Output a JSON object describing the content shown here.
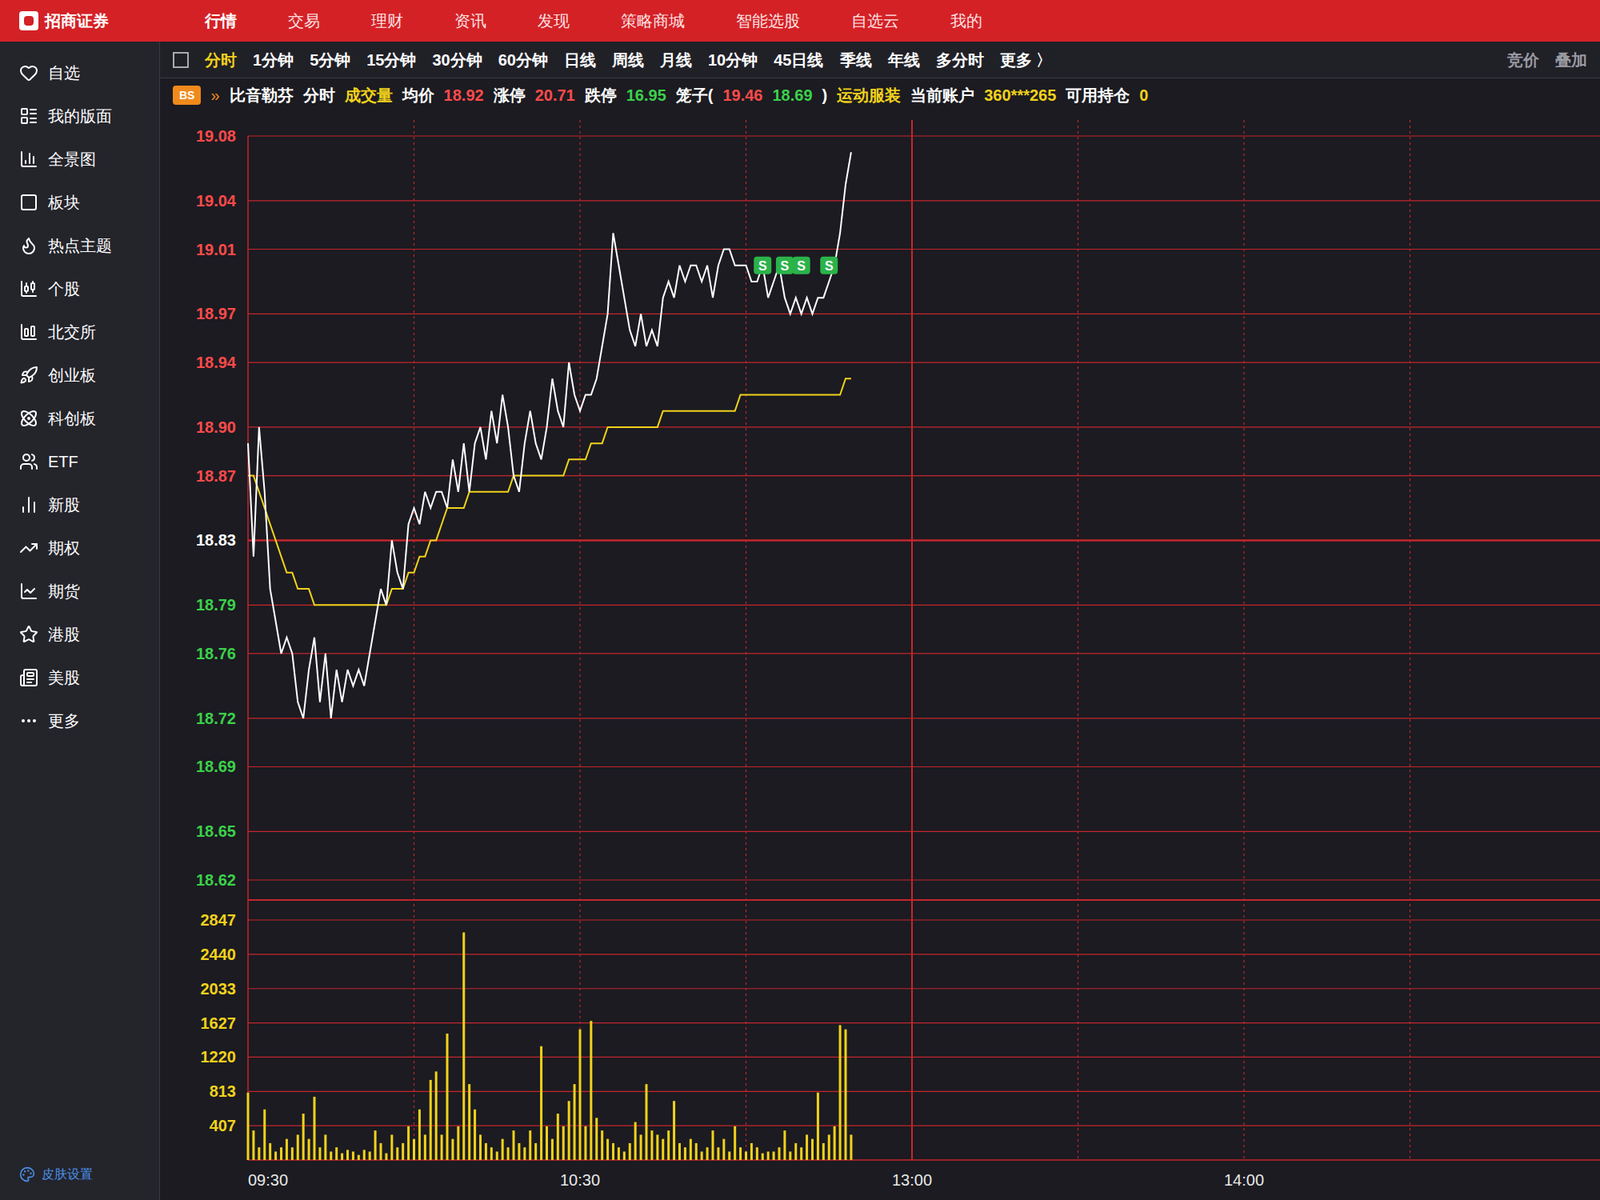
{
  "app": {
    "logo": "招商证券",
    "menu": [
      {
        "label": "行情",
        "selected": true
      },
      {
        "label": "交易",
        "selected": false
      },
      {
        "label": "理财",
        "selected": false
      },
      {
        "label": "资讯",
        "selected": false
      },
      {
        "label": "发现",
        "selected": false
      },
      {
        "label": "策略商城",
        "selected": false
      },
      {
        "label": "智能选股",
        "selected": false
      },
      {
        "label": "自选云",
        "selected": false
      },
      {
        "label": "我的",
        "selected": false
      }
    ]
  },
  "sidebar": {
    "items": [
      {
        "label": "自选",
        "selected": false
      },
      {
        "label": "我的版面",
        "selected": false
      },
      {
        "label": "全景图",
        "selected": false
      },
      {
        "label": "板块",
        "selected": false
      },
      {
        "label": "热点主题",
        "selected": false
      },
      {
        "label": "个股",
        "selected": false
      },
      {
        "label": "北交所",
        "selected": false
      },
      {
        "label": "创业板",
        "selected": false
      },
      {
        "label": "科创板",
        "selected": false
      },
      {
        "label": "ETF",
        "selected": false
      },
      {
        "label": "新股",
        "selected": false
      },
      {
        "label": "期权",
        "selected": false
      },
      {
        "label": "期货",
        "selected": false
      },
      {
        "label": "港股",
        "selected": false
      },
      {
        "label": "美股",
        "selected": false
      },
      {
        "label": "更多",
        "selected": false
      }
    ],
    "footer": "皮肤设置"
  },
  "periods": [
    {
      "label": "分时",
      "selected": true
    },
    {
      "label": "1分钟",
      "selected": false
    },
    {
      "label": "5分钟",
      "selected": false
    },
    {
      "label": "15分钟",
      "selected": false
    },
    {
      "label": "30分钟",
      "selected": false
    },
    {
      "label": "60分钟",
      "selected": false
    },
    {
      "label": "日线",
      "selected": false
    },
    {
      "label": "周线",
      "selected": false
    },
    {
      "label": "月线",
      "selected": false
    },
    {
      "label": "10分钟",
      "selected": false
    },
    {
      "label": "45日线",
      "selected": false
    },
    {
      "label": "季线",
      "selected": false
    },
    {
      "label": "年线",
      "selected": false
    },
    {
      "label": "多分时",
      "selected": false
    },
    {
      "label": "更多 〉",
      "selected": false
    }
  ],
  "toolbar_right": [
    "竞价",
    "叠加"
  ],
  "info": {
    "badge": "BS",
    "collapse": "»",
    "segments": [
      {
        "text": "比音勒芬",
        "color": "#ffffff"
      },
      {
        "text": "分时",
        "color": "#ffffff"
      },
      {
        "text": "成交量",
        "color": "#f2d21b"
      },
      {
        "text": "均价",
        "color": "#ffffff"
      },
      {
        "text": "18.92",
        "color": "#ff4a4a"
      },
      {
        "text": "涨停",
        "color": "#ffffff"
      },
      {
        "text": "20.71",
        "color": "#ff4a4a"
      },
      {
        "text": "跌停",
        "color": "#ffffff"
      },
      {
        "text": "16.95",
        "color": "#3bd14a"
      },
      {
        "text": "笼子(",
        "color": "#ffffff"
      },
      {
        "text": "19.46",
        "color": "#ff4a4a"
      },
      {
        "text": "18.69",
        "color": "#3bd14a"
      },
      {
        "text": ")",
        "color": "#ffffff"
      },
      {
        "text": "运动服装",
        "color": "#f2d21b"
      },
      {
        "text": "当前账户",
        "color": "#ffffff"
      },
      {
        "text": "360***265",
        "color": "#f2d21b"
      },
      {
        "text": "可用持仓",
        "color": "#ffffff"
      },
      {
        "text": "0",
        "color": "#f2d21b"
      }
    ]
  },
  "chart": {
    "price_ticks": [
      {
        "label": "19.08",
        "color": "#ff4a4a"
      },
      {
        "label": "19.04",
        "color": "#ff4a4a"
      },
      {
        "label": "19.01",
        "color": "#ff4a4a"
      },
      {
        "label": "18.97",
        "color": "#ff4a4a"
      },
      {
        "label": "18.94",
        "color": "#ff4a4a"
      },
      {
        "label": "18.90",
        "color": "#ff4a4a"
      },
      {
        "label": "18.87",
        "color": "#ff4a4a"
      },
      {
        "label": "18.83",
        "color": "#ffffff"
      },
      {
        "label": "18.79",
        "color": "#3bd14a"
      },
      {
        "label": "18.76",
        "color": "#3bd14a"
      },
      {
        "label": "18.72",
        "color": "#3bd14a"
      },
      {
        "label": "18.69",
        "color": "#3bd14a"
      },
      {
        "label": "18.65",
        "color": "#3bd14a"
      },
      {
        "label": "18.62",
        "color": "#3bd14a"
      }
    ],
    "volume_ticks": [
      "2847",
      "2440",
      "2033",
      "1627",
      "1220",
      "813",
      "407"
    ],
    "time_labels": [
      "09:30",
      "10:30",
      "13:00",
      "14:00"
    ],
    "price": [
      18.89,
      18.82,
      18.9,
      18.86,
      18.8,
      18.78,
      18.76,
      18.77,
      18.76,
      18.73,
      18.72,
      18.75,
      18.77,
      18.73,
      18.76,
      18.72,
      18.75,
      18.73,
      18.75,
      18.74,
      18.75,
      18.74,
      18.76,
      18.78,
      18.8,
      18.79,
      18.83,
      18.81,
      18.8,
      18.84,
      18.85,
      18.84,
      18.86,
      18.85,
      18.86,
      18.86,
      18.85,
      18.88,
      18.86,
      18.89,
      18.86,
      18.89,
      18.9,
      18.88,
      18.91,
      18.89,
      18.92,
      18.9,
      18.87,
      18.86,
      18.89,
      18.91,
      18.89,
      18.88,
      18.9,
      18.93,
      18.91,
      18.9,
      18.94,
      18.92,
      18.91,
      18.92,
      18.92,
      18.93,
      18.95,
      18.97,
      19.02,
      19.0,
      18.98,
      18.96,
      18.95,
      18.97,
      18.95,
      18.96,
      18.95,
      18.98,
      18.99,
      18.98,
      19.0,
      18.99,
      19.0,
      19.0,
      18.99,
      19.0,
      18.98,
      19.0,
      19.01,
      19.01,
      19.0,
      19.0,
      19.0,
      18.99,
      18.99,
      19.0,
      18.98,
      18.99,
      19.0,
      18.98,
      18.97,
      18.98,
      18.97,
      18.98,
      18.97,
      18.98,
      18.98,
      18.99,
      19.0,
      19.02,
      19.05,
      19.07
    ],
    "average": [
      18.87,
      18.87,
      18.86,
      18.85,
      18.84,
      18.83,
      18.82,
      18.81,
      18.81,
      18.8,
      18.8,
      18.8,
      18.79,
      18.79,
      18.79,
      18.79,
      18.79,
      18.79,
      18.79,
      18.79,
      18.79,
      18.79,
      18.79,
      18.79,
      18.79,
      18.79,
      18.8,
      18.8,
      18.8,
      18.81,
      18.81,
      18.82,
      18.82,
      18.83,
      18.83,
      18.84,
      18.85,
      18.85,
      18.85,
      18.85,
      18.86,
      18.86,
      18.86,
      18.86,
      18.86,
      18.86,
      18.86,
      18.86,
      18.87,
      18.87,
      18.87,
      18.87,
      18.87,
      18.87,
      18.87,
      18.87,
      18.87,
      18.87,
      18.88,
      18.88,
      18.88,
      18.88,
      18.89,
      18.89,
      18.89,
      18.9,
      18.9,
      18.9,
      18.9,
      18.9,
      18.9,
      18.9,
      18.9,
      18.9,
      18.9,
      18.91,
      18.91,
      18.91,
      18.91,
      18.91,
      18.91,
      18.91,
      18.91,
      18.91,
      18.91,
      18.91,
      18.91,
      18.91,
      18.91,
      18.92,
      18.92,
      18.92,
      18.92,
      18.92,
      18.92,
      18.92,
      18.92,
      18.92,
      18.92,
      18.92,
      18.92,
      18.92,
      18.92,
      18.92,
      18.92,
      18.92,
      18.92,
      18.92,
      18.93,
      18.93
    ],
    "volume": [
      800,
      350,
      150,
      600,
      200,
      100,
      150,
      250,
      150,
      300,
      550,
      250,
      750,
      150,
      300,
      100,
      150,
      80,
      120,
      100,
      60,
      120,
      100,
      350,
      200,
      80,
      300,
      150,
      200,
      400,
      250,
      600,
      300,
      950,
      1050,
      300,
      1500,
      250,
      400,
      2700,
      900,
      600,
      300,
      200,
      150,
      100,
      250,
      150,
      350,
      200,
      150,
      350,
      200,
      1350,
      400,
      250,
      550,
      400,
      700,
      900,
      1550,
      400,
      1650,
      500,
      350,
      250,
      200,
      150,
      100,
      200,
      450,
      300,
      900,
      350,
      300,
      250,
      350,
      700,
      200,
      150,
      250,
      200,
      100,
      150,
      350,
      150,
      250,
      100,
      400,
      150,
      100,
      200,
      150,
      80,
      100,
      100,
      150,
      350,
      100,
      200,
      150,
      300,
      250,
      800,
      200,
      300,
      400,
      1600,
      1550,
      300
    ],
    "signals": [
      {
        "label": "S",
        "minute": 93,
        "price": 19.0
      },
      {
        "label": "S",
        "minute": 97,
        "price": 19.0
      },
      {
        "label": "S",
        "minute": 100,
        "price": 19.0
      },
      {
        "label": "S",
        "minute": 105,
        "price": 19.0
      }
    ]
  }
}
